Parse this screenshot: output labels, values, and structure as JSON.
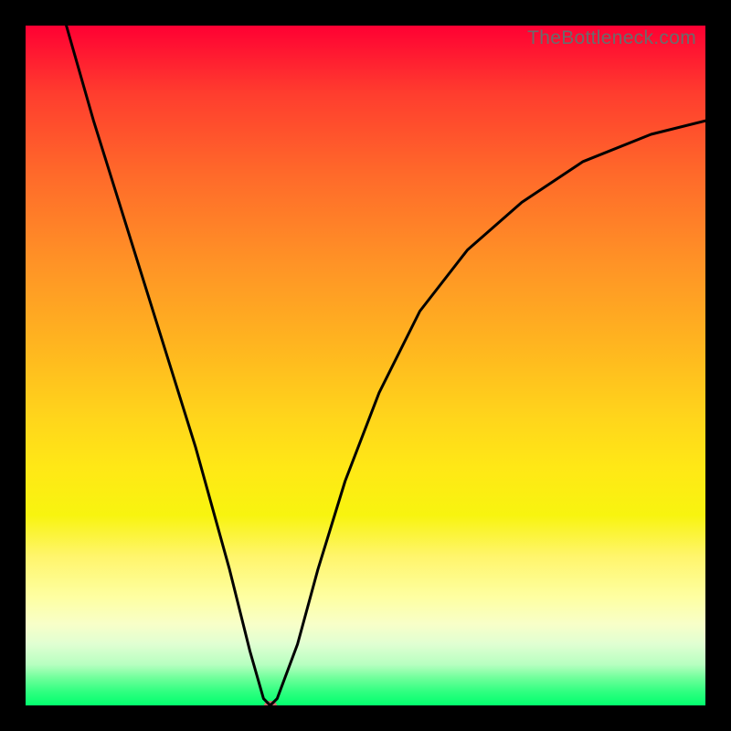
{
  "watermark": "TheBottleneck.com",
  "chart_data": {
    "type": "line",
    "title": "",
    "xlabel": "",
    "ylabel": "",
    "xlim": [
      0,
      100
    ],
    "ylim": [
      0,
      100
    ],
    "series": [
      {
        "name": "curve",
        "x": [
          6,
          10,
          15,
          20,
          25,
          30,
          33,
          35,
          36,
          37,
          40,
          43,
          47,
          52,
          58,
          65,
          73,
          82,
          92,
          100
        ],
        "y": [
          100,
          86,
          70,
          54,
          38,
          20,
          8,
          1,
          0,
          1,
          9,
          20,
          33,
          46,
          58,
          67,
          74,
          80,
          84,
          86
        ]
      }
    ],
    "min_point": {
      "x": 36,
      "y": 0
    },
    "gradient_stops": [
      {
        "pct": 0,
        "color": "#ff0033"
      },
      {
        "pct": 50,
        "color": "#ffd61b"
      },
      {
        "pct": 85,
        "color": "#fff56b"
      },
      {
        "pct": 100,
        "color": "#03ff6e"
      }
    ]
  }
}
